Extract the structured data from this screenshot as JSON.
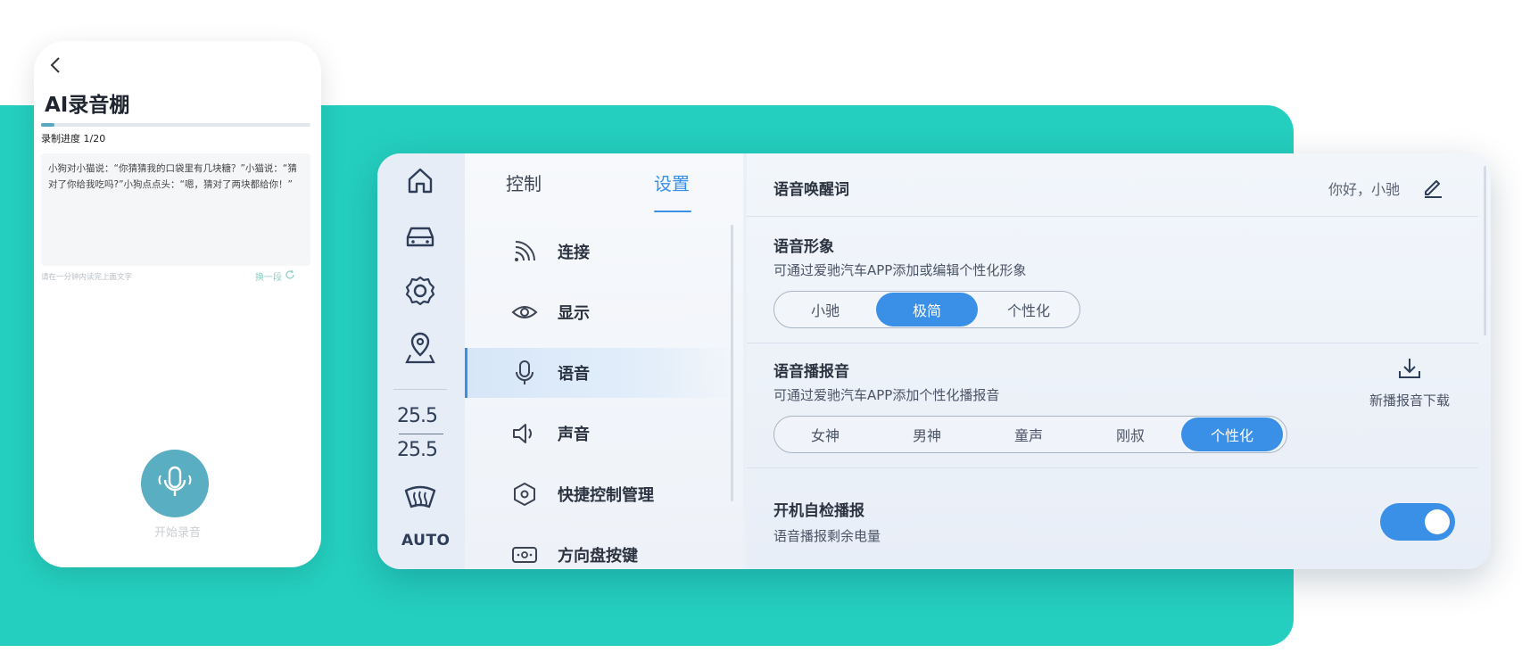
{
  "phone": {
    "title": "AI录音棚",
    "progress_label": "录制进度 1/20",
    "progress_fraction": 0.05,
    "script_text": "小狗对小猫说：“你猜猜我的口袋里有几块糖？”小猫说：“猜对了你给我吃吗?”小狗点点头：“嗯，猜对了两块都给你！”",
    "hint": "请在一分钟内读完上面文字",
    "swap_label": "换一段",
    "record_label": "开始录音"
  },
  "rail": {
    "temp_left": "25.5",
    "temp_right": "25.5",
    "auto_label": "AUTO"
  },
  "menu": {
    "tabs": [
      {
        "label": "控制"
      },
      {
        "label": "设置"
      }
    ],
    "items": [
      {
        "label": "连接",
        "icon": "wifi-icon"
      },
      {
        "label": "显示",
        "icon": "eye-icon"
      },
      {
        "label": "语音",
        "icon": "microphone-icon"
      },
      {
        "label": "声音",
        "icon": "speaker-icon"
      },
      {
        "label": "快捷控制管理",
        "icon": "hexagon-icon"
      },
      {
        "label": "方向盘按键",
        "icon": "steering-key-icon"
      }
    ]
  },
  "content": {
    "wake_title": "语音唤醒词",
    "wake_value": "你好，小驰",
    "avatar_title": "语音形象",
    "avatar_sub": "可通过爱驰汽车APP添加或编辑个性化形象",
    "avatar_options": [
      "小驰",
      "极简",
      "个性化"
    ],
    "broadcast_title": "语音播报音",
    "broadcast_sub": "可通过爱驰汽车APP添加个性化播报音",
    "broadcast_options": [
      "女神",
      "男神",
      "童声",
      "刚叔",
      "个性化"
    ],
    "download_label": "新播报音下载",
    "selfcheck_title": "开机自检播报",
    "selfcheck_sub": "语音播报剩余电量"
  },
  "colors": {
    "teal": "#24cfbf",
    "accent": "#3a8fe6",
    "phone_accent": "#5aaec2"
  }
}
